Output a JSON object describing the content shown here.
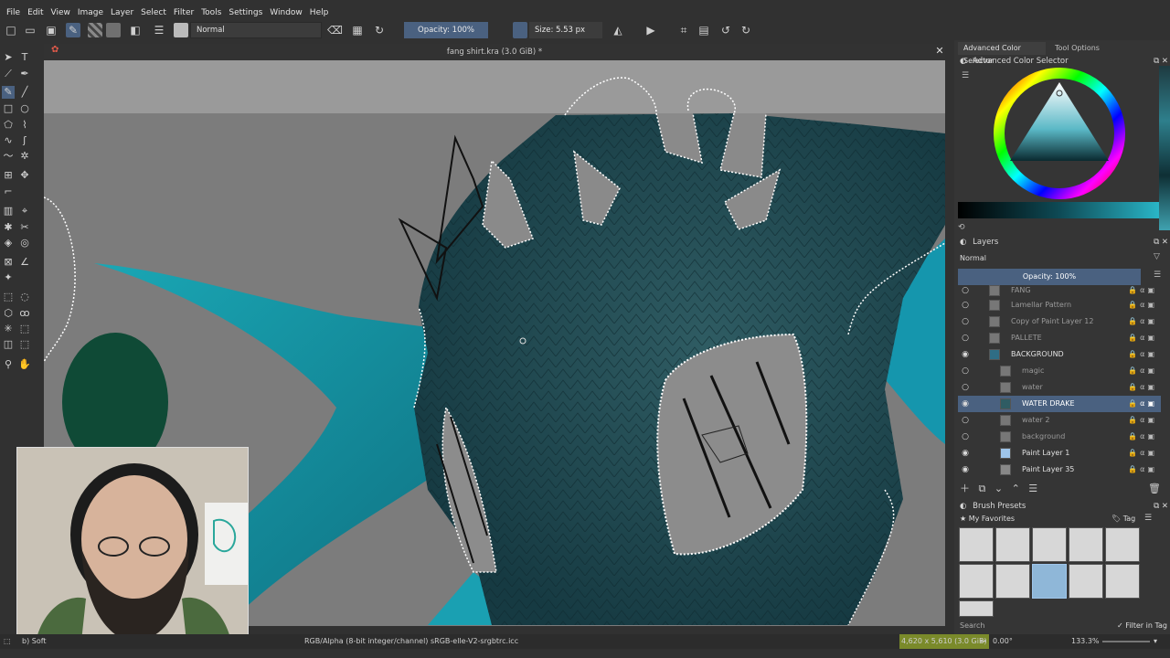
{
  "menu": [
    "File",
    "Edit",
    "View",
    "Image",
    "Layer",
    "Select",
    "Filter",
    "Tools",
    "Settings",
    "Window",
    "Help"
  ],
  "toolbar": {
    "blend_mode": "Normal",
    "opacity": "Opacity: 100%",
    "size": "Size: 5.53 px"
  },
  "document": {
    "title": "fang shirt.kra (3.0 GiB) *"
  },
  "right_panel": {
    "tabs": [
      "Advanced Color Selector",
      "Tool Options"
    ],
    "color_selector_title": "Advanced Color Selector",
    "layers_title": "Layers",
    "layers_blend": "Normal",
    "layers_opacity": "Opacity:  100%",
    "layers": [
      {
        "name": "FANG",
        "visible": false,
        "selected": false
      },
      {
        "name": "Lamellar Pattern",
        "visible": false,
        "selected": false
      },
      {
        "name": "Copy of Paint Layer 12",
        "visible": false,
        "selected": false
      },
      {
        "name": "PALLETE",
        "visible": false,
        "selected": false
      },
      {
        "name": "BACKGROUND",
        "visible": true,
        "selected": false
      },
      {
        "name": "magic",
        "visible": false,
        "selected": false
      },
      {
        "name": "water",
        "visible": false,
        "selected": false
      },
      {
        "name": "WATER DRAKE",
        "visible": true,
        "selected": true
      },
      {
        "name": "water 2",
        "visible": false,
        "selected": false
      },
      {
        "name": "background",
        "visible": false,
        "selected": false
      },
      {
        "name": "Paint Layer 1",
        "visible": true,
        "selected": false
      },
      {
        "name": "Paint Layer 35",
        "visible": true,
        "selected": false
      }
    ],
    "brush_presets_title": "Brush Presets",
    "brush_tag": "My Favorites",
    "tag_label": "Tag",
    "search_placeholder": "Search",
    "filter_in_tag": "Filter in Tag"
  },
  "status": {
    "left": "b) Soft",
    "color_space": "RGB/Alpha (8-bit integer/channel)  sRGB-elle-V2-srgbtrc.icc",
    "dimensions": "4,620 x 5,610 (3.0 GiB)",
    "rotation": "0.00°",
    "zoom": "133.3%"
  },
  "colors": {
    "accent": "#4a6180",
    "drake_teal": "#1e4a52",
    "water_cyan": "#12a3b8",
    "background_gray": "#7c7c7c"
  }
}
